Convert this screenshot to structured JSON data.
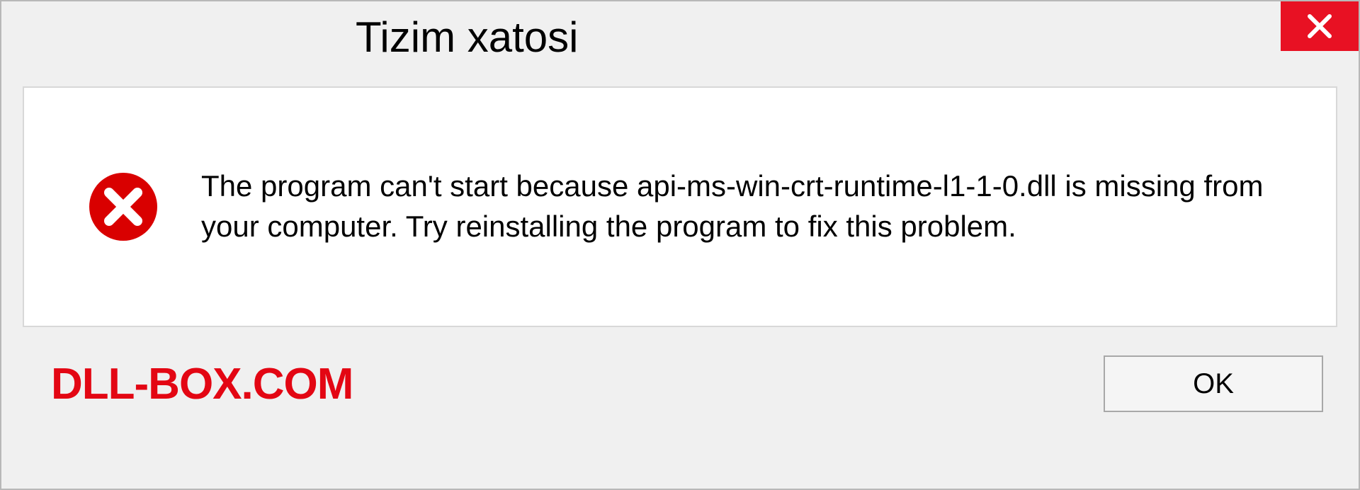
{
  "dialog": {
    "title": "Tizim xatosi",
    "message": "The program can't start because api-ms-win-crt-runtime-l1-1-0.dll is missing from your computer. Try reinstalling the program to fix this problem.",
    "ok_label": "OK"
  },
  "watermark": "DLL-BOX.COM"
}
